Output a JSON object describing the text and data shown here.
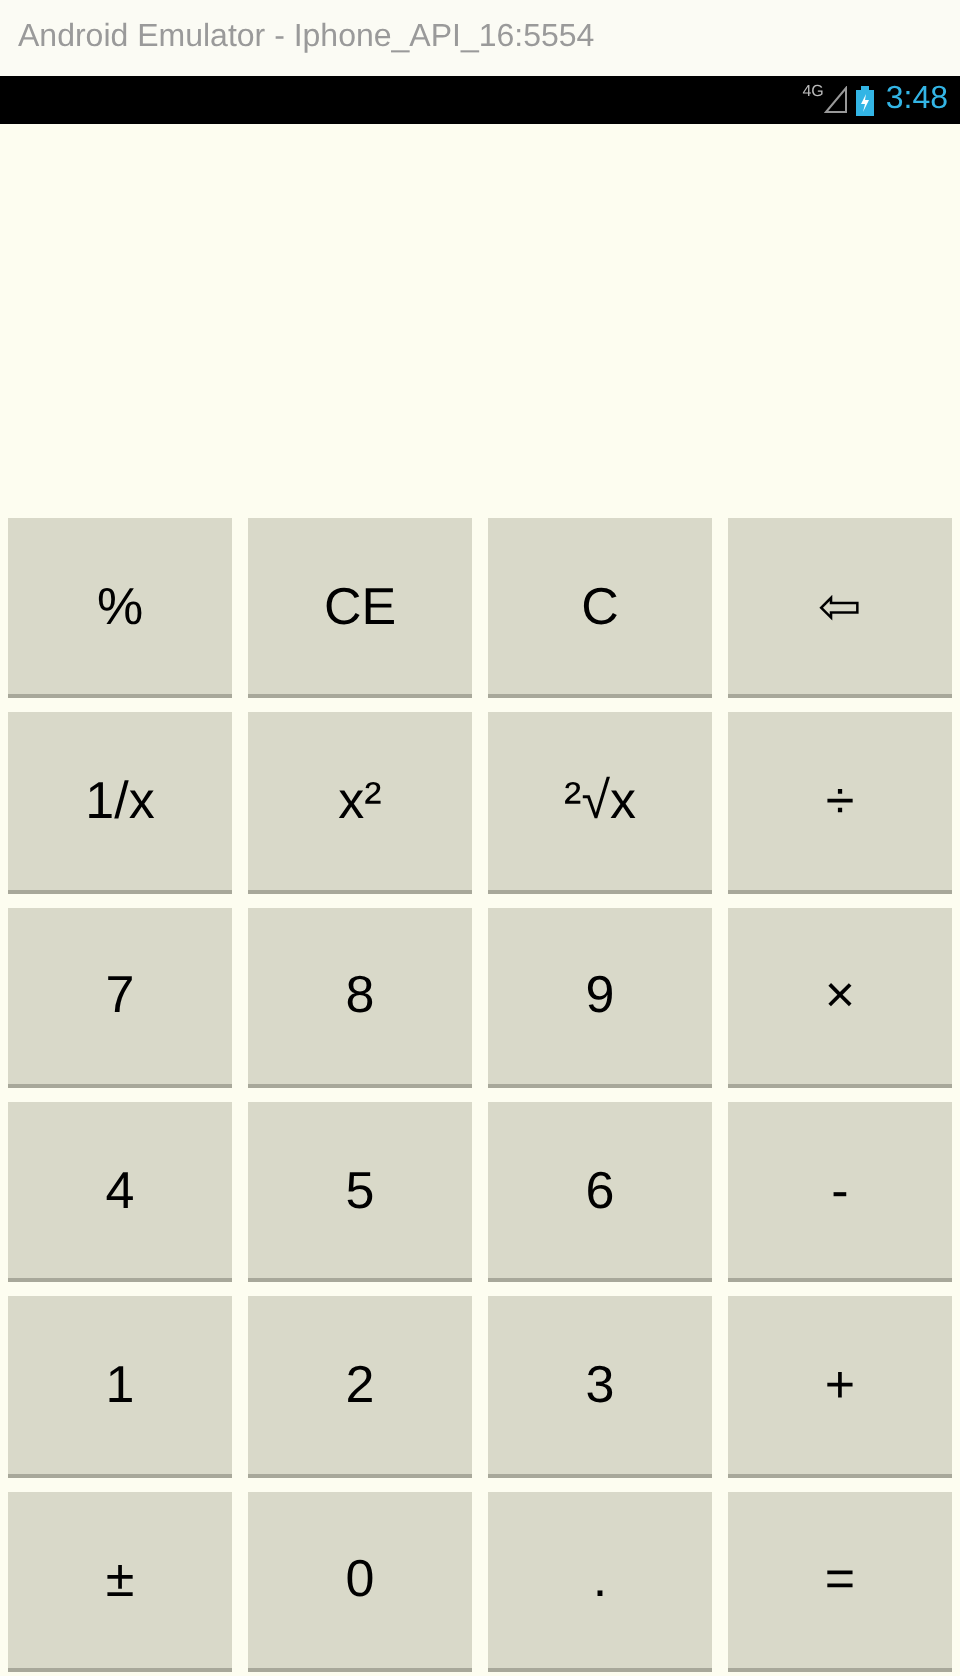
{
  "window": {
    "title": "Android Emulator - Iphone_API_16:5554"
  },
  "status_bar": {
    "network": "4G",
    "time": "3:48"
  },
  "keys": [
    {
      "label": "%"
    },
    {
      "label": "CE"
    },
    {
      "label": "C"
    },
    {
      "label": "⇦"
    },
    {
      "label": "1/x"
    },
    {
      "label": "x²"
    },
    {
      "label": "²√x"
    },
    {
      "label": "÷"
    },
    {
      "label": "7"
    },
    {
      "label": "8"
    },
    {
      "label": "9"
    },
    {
      "label": "×"
    },
    {
      "label": "4"
    },
    {
      "label": "5"
    },
    {
      "label": "6"
    },
    {
      "label": "-"
    },
    {
      "label": "1"
    },
    {
      "label": "2"
    },
    {
      "label": "3"
    },
    {
      "label": "+"
    },
    {
      "label": "±"
    },
    {
      "label": "0"
    },
    {
      "label": "."
    },
    {
      "label": "="
    }
  ]
}
